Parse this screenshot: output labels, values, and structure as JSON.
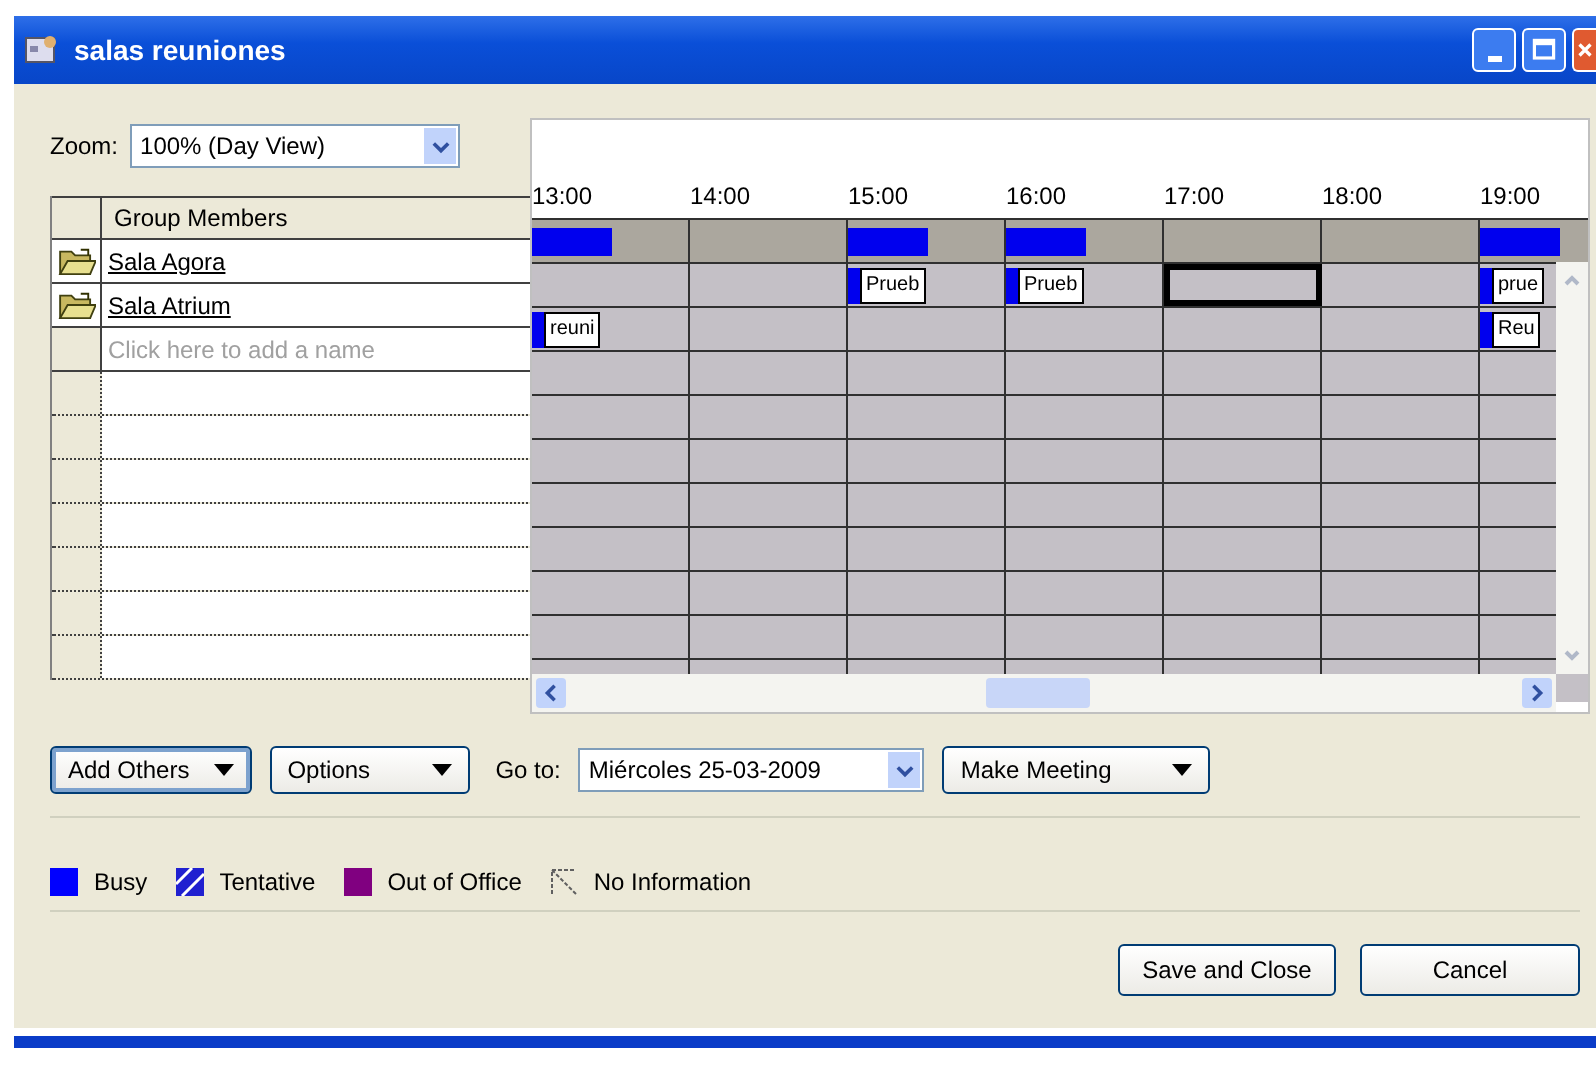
{
  "window": {
    "title": "salas reuniones"
  },
  "zoom": {
    "label": "Zoom:",
    "value": "100% (Day View)"
  },
  "times": [
    "13:00",
    "14:00",
    "15:00",
    "16:00",
    "17:00",
    "18:00",
    "19:00"
  ],
  "members_header": "Group Members",
  "all_attendees": [
    {
      "busy": true
    },
    {
      "busy": false
    },
    {
      "busy": true
    },
    {
      "busy": true
    },
    {
      "busy": false
    },
    {
      "busy": false
    },
    {
      "busy": true
    }
  ],
  "members": [
    {
      "name": "Sala Agora",
      "slots": [
        {
          "busy": false,
          "selected": false
        },
        {
          "busy": false,
          "selected": false
        },
        {
          "busy": true,
          "label": "Prueb",
          "selected": false
        },
        {
          "busy": true,
          "label": "Prueb",
          "selected": false
        },
        {
          "busy": false,
          "selected": true
        },
        {
          "busy": false,
          "selected": false
        },
        {
          "busy": true,
          "label": "prue",
          "selected": false
        }
      ]
    },
    {
      "name": "Sala Atrium",
      "slots": [
        {
          "busy": true,
          "label": "reuni",
          "selected": false
        },
        {
          "busy": false,
          "selected": false
        },
        {
          "busy": false,
          "selected": false
        },
        {
          "busy": false,
          "selected": false
        },
        {
          "busy": false,
          "selected": false
        },
        {
          "busy": false,
          "selected": false
        },
        {
          "busy": true,
          "label": "Reu",
          "selected": false
        }
      ]
    }
  ],
  "add_name_placeholder": "Click here to add a name",
  "buttons": [
    {
      "label": "Add Others",
      "focused": true
    },
    {
      "label": "Options",
      "focused": false
    }
  ],
  "goto": {
    "label": "Go to:",
    "value": "Miércoles 25-03-2009"
  },
  "make_meeting": "Make Meeting",
  "legend": [
    {
      "kind": "solid",
      "color": "#0000ff",
      "label": "Busy"
    },
    {
      "kind": "hatched",
      "color": "#2020d0",
      "label": "Tentative"
    },
    {
      "kind": "solid",
      "color": "#800080",
      "label": "Out of Office"
    },
    {
      "kind": "none",
      "color": "#606060",
      "label": "No Information"
    }
  ],
  "footer_buttons": [
    "Save and Close",
    "Cancel"
  ]
}
